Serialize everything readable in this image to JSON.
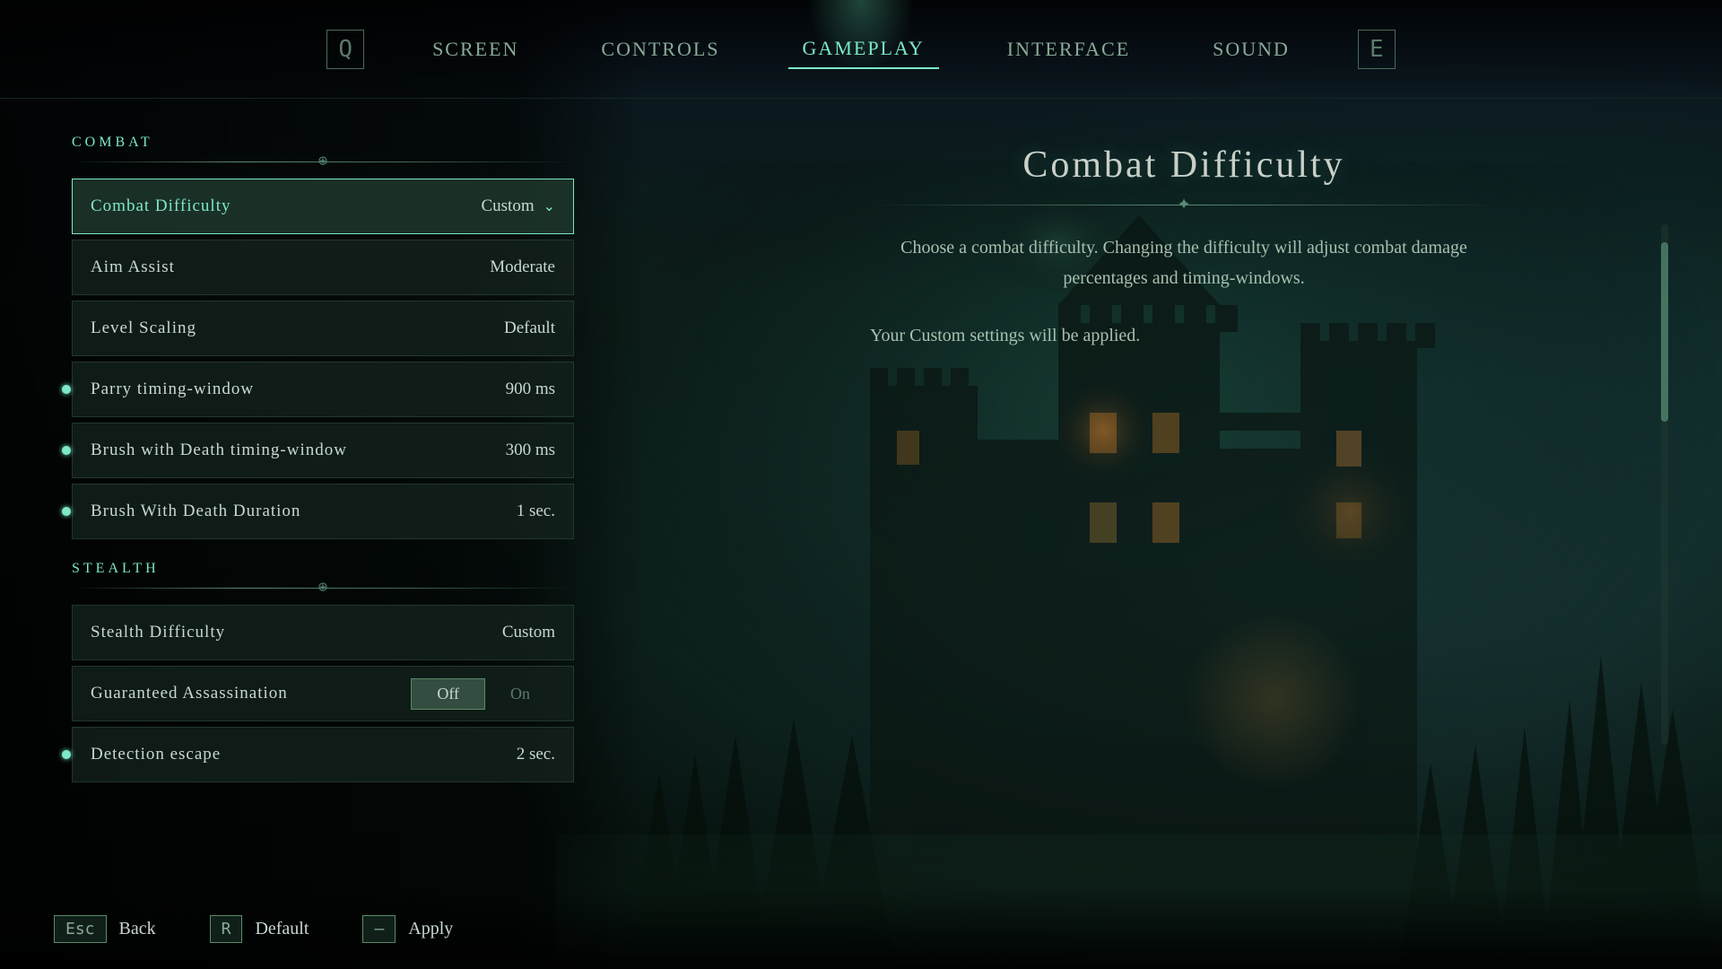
{
  "nav": {
    "items": [
      {
        "id": "screen",
        "label": "Screen",
        "active": false
      },
      {
        "id": "controls",
        "label": "Controls",
        "active": false
      },
      {
        "id": "gameplay",
        "label": "Gameplay",
        "active": true
      },
      {
        "id": "interface",
        "label": "Interface",
        "active": false
      },
      {
        "id": "sound",
        "label": "Sound",
        "active": false
      }
    ],
    "left_bracket": "Q",
    "right_bracket": "E"
  },
  "combat_section": {
    "header": "COMBAT",
    "settings": [
      {
        "id": "combat-difficulty",
        "label": "Combat Difficulty",
        "value": "Custom",
        "selected": true,
        "has_chevron": true,
        "has_dot": false
      },
      {
        "id": "aim-assist",
        "label": "Aim Assist",
        "value": "Moderate",
        "selected": false,
        "has_chevron": false,
        "has_dot": false
      },
      {
        "id": "level-scaling",
        "label": "Level Scaling",
        "value": "Default",
        "selected": false,
        "has_chevron": false,
        "has_dot": false
      },
      {
        "id": "parry-timing",
        "label": "Parry timing-window",
        "value": "900 ms",
        "selected": false,
        "has_chevron": false,
        "has_dot": true
      },
      {
        "id": "brush-timing",
        "label": "Brush with Death timing-window",
        "value": "300 ms",
        "selected": false,
        "has_chevron": false,
        "has_dot": true
      },
      {
        "id": "brush-duration",
        "label": "Brush With Death Duration",
        "value": "1 sec.",
        "selected": false,
        "has_chevron": false,
        "has_dot": true
      }
    ]
  },
  "stealth_section": {
    "header": "STEALTH",
    "settings": [
      {
        "id": "stealth-difficulty",
        "label": "Stealth Difficulty",
        "value": "Custom",
        "selected": false,
        "has_chevron": false,
        "has_dot": false,
        "toggle": false
      },
      {
        "id": "guaranteed-assassination",
        "label": "Guaranteed Assassination",
        "value": "",
        "selected": false,
        "has_chevron": false,
        "has_dot": false,
        "toggle": true,
        "toggle_off_active": true,
        "toggle_off_label": "Off",
        "toggle_on_label": "On"
      },
      {
        "id": "detection-escape",
        "label": "Detection escape",
        "value": "2 sec.",
        "selected": false,
        "has_chevron": false,
        "has_dot": true,
        "toggle": false
      }
    ]
  },
  "info_panel": {
    "title": "Combat Difficulty",
    "description": "Choose a combat difficulty. Changing the difficulty will adjust combat damage percentages and timing-windows.",
    "note": "Your Custom settings will be applied."
  },
  "bottom_bar": {
    "actions": [
      {
        "id": "back",
        "key": "Esc",
        "label": "Back"
      },
      {
        "id": "default",
        "key": "R",
        "label": "Default"
      },
      {
        "id": "apply",
        "key": "—",
        "label": "Apply"
      }
    ]
  }
}
